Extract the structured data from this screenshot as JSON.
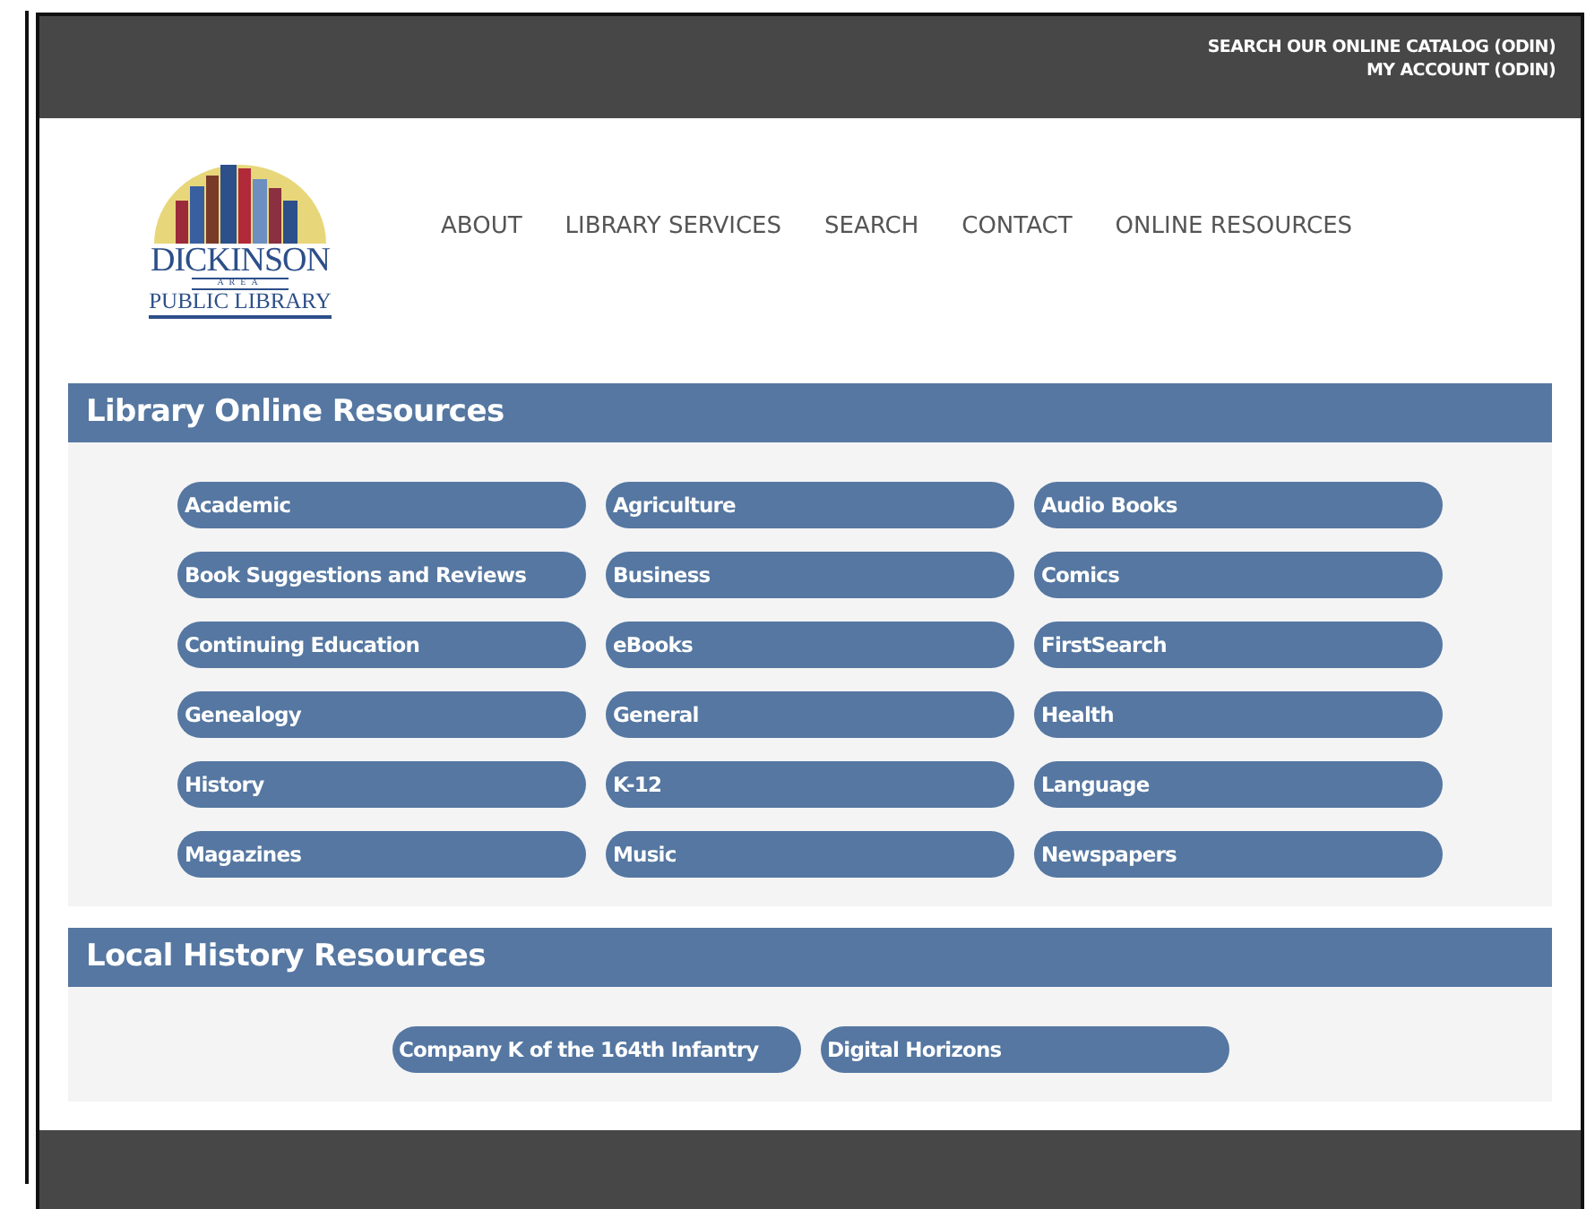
{
  "top_links": [
    "SEARCH OUR ONLINE CATALOG (ODIN)",
    "MY ACCOUNT (ODIN)"
  ],
  "logo": {
    "name": "DICKINSON",
    "area": "AREA",
    "subtitle": "PUBLIC LIBRARY"
  },
  "nav": [
    "ABOUT",
    "LIBRARY SERVICES",
    "SEARCH",
    "CONTACT",
    "ONLINE RESOURCES"
  ],
  "sections": [
    {
      "title": "Library Online Resources",
      "links": [
        "Academic",
        "Agriculture",
        "Audio Books",
        "Book Suggestions and Reviews",
        "Business",
        "Comics",
        "Continuing Education",
        "eBooks",
        "FirstSearch",
        "Genealogy",
        "General",
        "Health",
        "History",
        "K-12",
        "Language",
        "Magazines",
        "Music",
        "Newspapers"
      ]
    },
    {
      "title": "Local History Resources",
      "links": [
        "Company K of the 164th Infantry",
        "Digital Horizons"
      ]
    }
  ]
}
